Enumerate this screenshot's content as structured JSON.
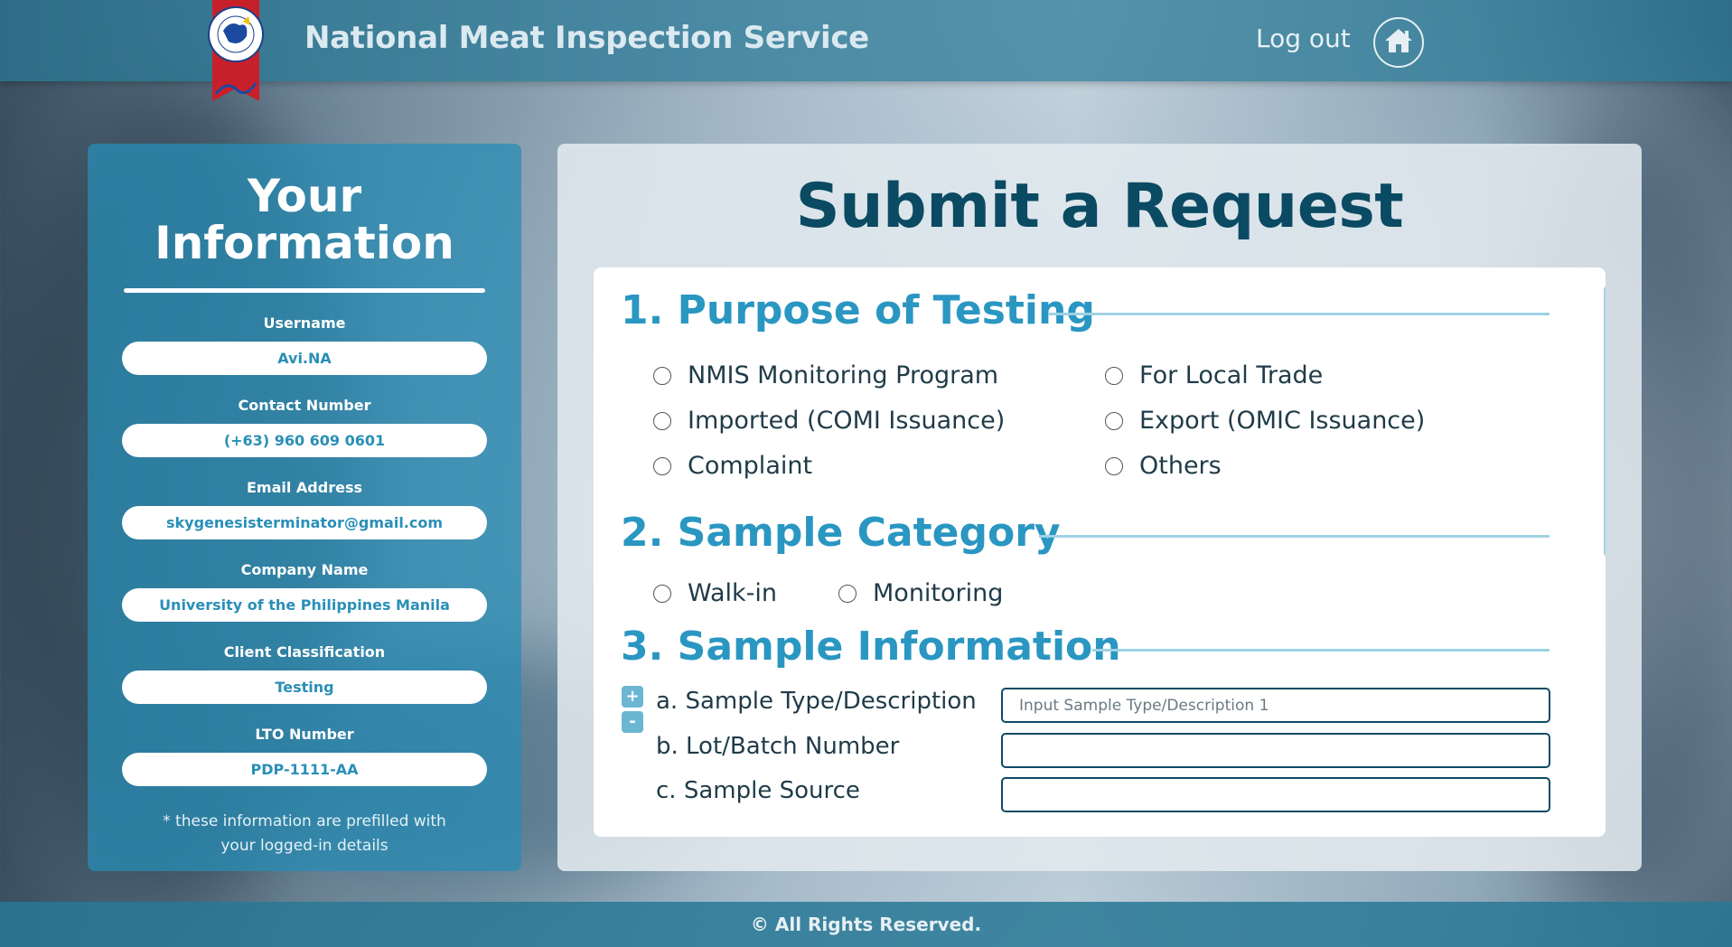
{
  "header": {
    "site_title": "National Meat Inspection Service",
    "logout_label": "Log out",
    "logo_text": "NATIONAL MEAT INSPECTION SERVICE 1972"
  },
  "info": {
    "title_line1": "Your",
    "title_line2": "Information",
    "fields": [
      {
        "label": "Username",
        "value": "Avi.NA"
      },
      {
        "label": "Contact Number",
        "value": "(+63) 960 609 0601"
      },
      {
        "label": "Email Address",
        "value": "skygenesisterminator@gmail.com"
      },
      {
        "label": "Company Name",
        "value": "University of the Philippines Manila"
      },
      {
        "label": "Client Classification",
        "value": "Testing"
      },
      {
        "label": "LTO Number",
        "value": "PDP-1111-AA"
      }
    ],
    "note_line1": "* these information are prefilled with",
    "note_line2": "your logged-in details"
  },
  "request": {
    "title": "Submit a Request",
    "section1": {
      "heading": "1. Purpose of Testing",
      "options": [
        "NMIS Monitoring Program",
        "For Local Trade",
        "Imported (COMI Issuance)",
        "Export (OMIC Issuance)",
        "Complaint",
        "Others"
      ]
    },
    "section2": {
      "heading": "2. Sample Category",
      "options": [
        "Walk-in",
        "Monitoring"
      ]
    },
    "section3": {
      "heading": "3. Sample Information",
      "plus": "+",
      "minus": "-",
      "sample_type_label": "a. Sample Type/Description",
      "sample_type_placeholder": "Input Sample Type/Description 1",
      "lot_label": "b. Lot/Batch Number",
      "source_label": "c. Sample Source"
    }
  },
  "footer": {
    "text": "© All Rights Reserved."
  }
}
